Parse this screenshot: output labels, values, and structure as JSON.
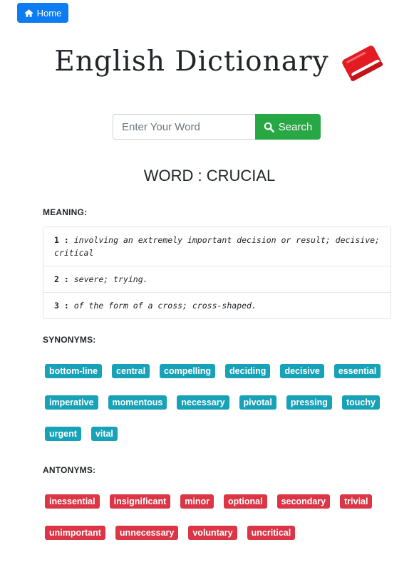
{
  "nav": {
    "home_label": "Home",
    "home_icon": "home-icon"
  },
  "header": {
    "title": "English Dictionary",
    "icon": "book-icon",
    "icon_color": "#e31b23"
  },
  "search": {
    "placeholder": "Enter Your Word",
    "value": "",
    "button_label": "Search",
    "button_icon": "search-icon",
    "button_color": "#28a745"
  },
  "result": {
    "word_heading": "WORD : CRUCIAL",
    "meaning_label": "MEANING:",
    "meanings": [
      {
        "num": "1 :",
        "text": "involving an extremely important decision or result; decisive; critical"
      },
      {
        "num": "2 :",
        "text": "severe; trying."
      },
      {
        "num": "3 :",
        "text": "of the form of a cross; cross-shaped."
      }
    ],
    "synonyms_label": "SYNONYMS:",
    "synonyms": [
      "bottom-line",
      "central",
      "compelling",
      "deciding",
      "decisive",
      "essential",
      "imperative",
      "momentous",
      "necessary",
      "pivotal",
      "pressing",
      "touchy",
      "urgent",
      "vital"
    ],
    "antonyms_label": "ANTONYMS:",
    "antonyms": [
      "inessential",
      "insignificant",
      "minor",
      "optional",
      "secondary",
      "trivial",
      "unimportant",
      "unnecessary",
      "voluntary",
      "uncritical"
    ],
    "synonym_color": "#17a2b8",
    "antonym_color": "#dc3545"
  }
}
